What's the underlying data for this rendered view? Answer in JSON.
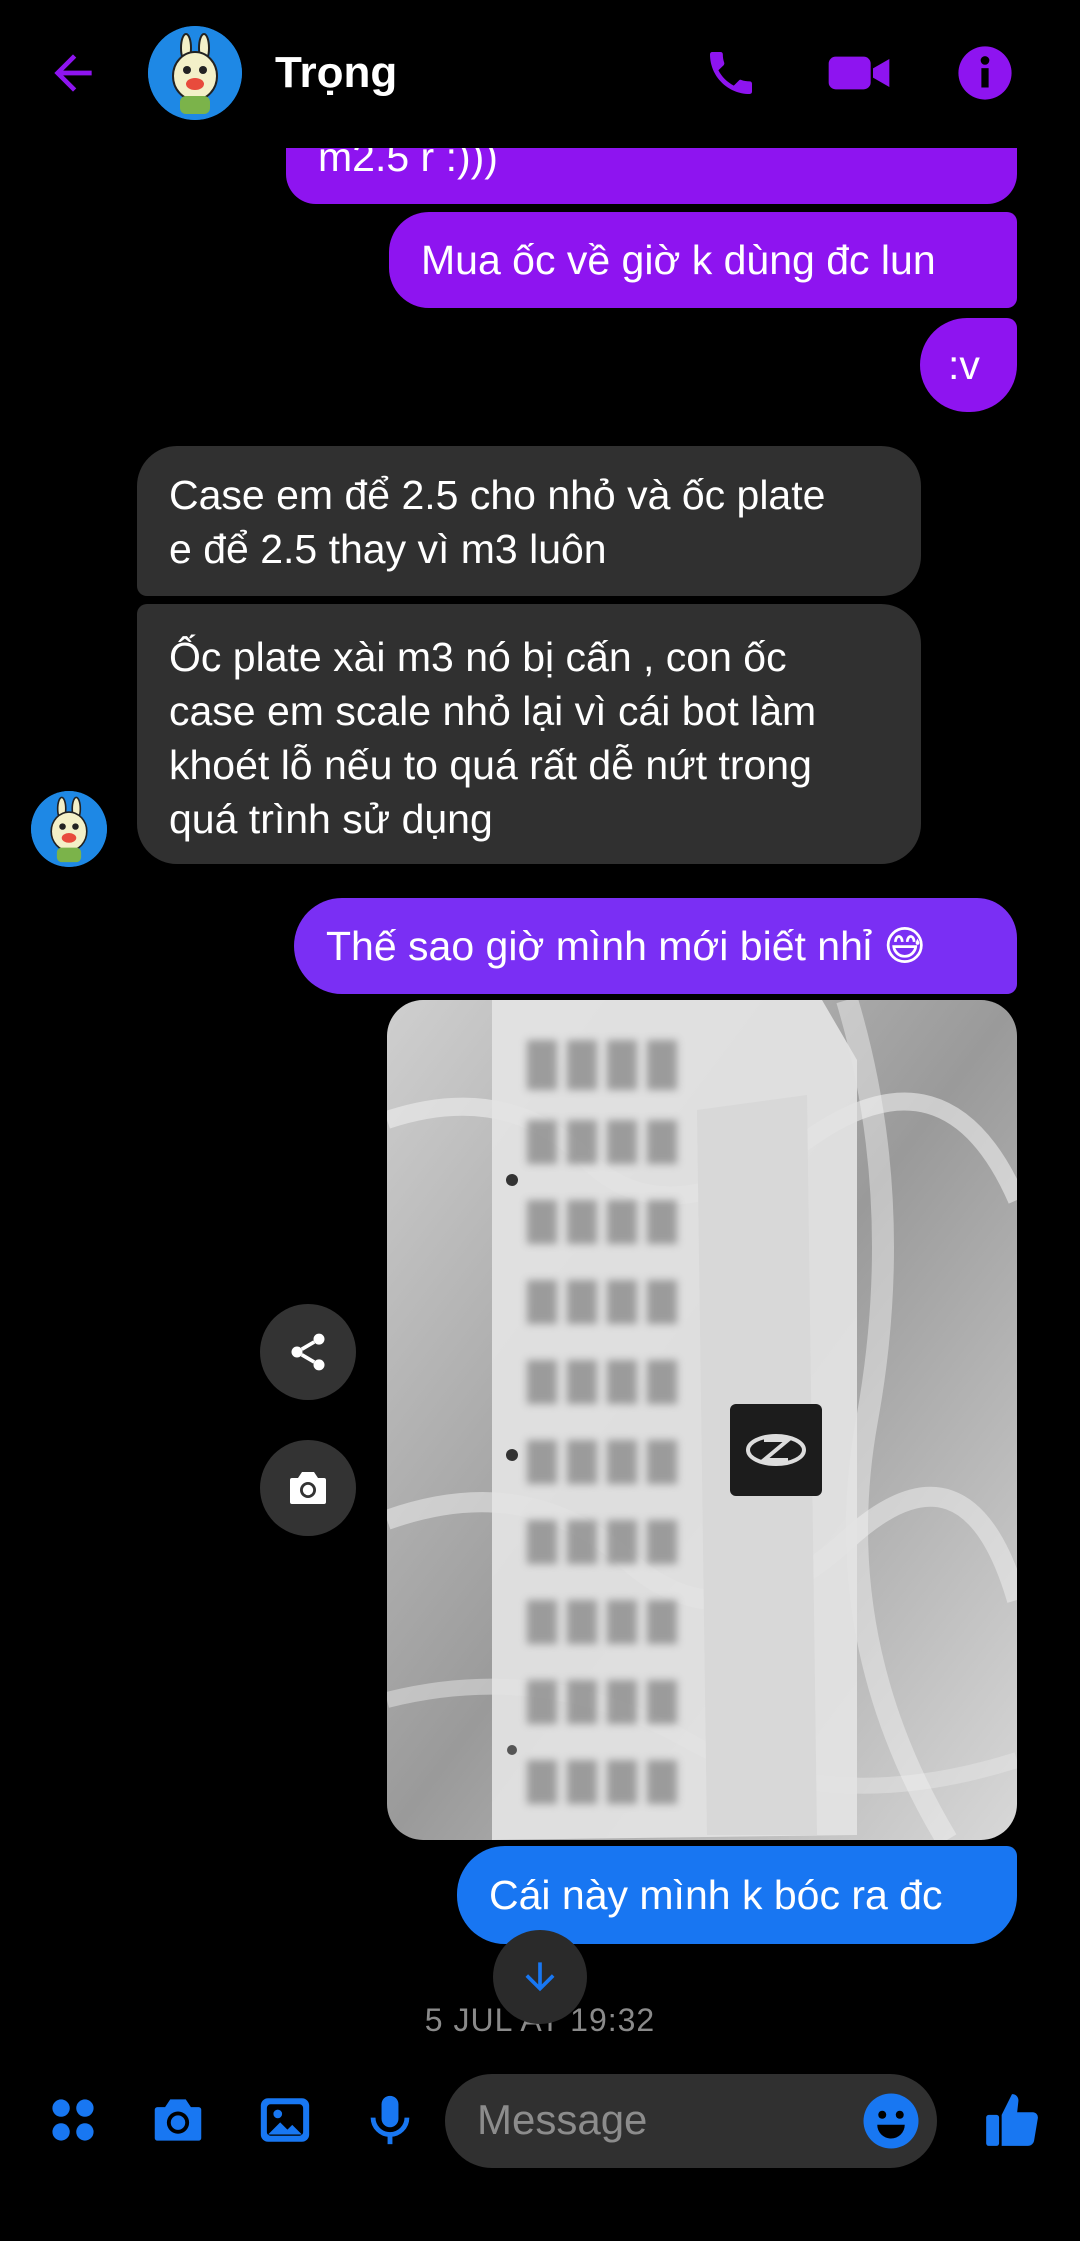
{
  "header": {
    "contact_name": "Trọng",
    "back_icon": "arrow-left-icon",
    "call_icon": "phone-icon",
    "video_icon": "video-camera-icon",
    "info_icon": "info-icon"
  },
  "messages": [
    {
      "id": "m0",
      "sender": "me",
      "text": "m2.5 r :)))"
    },
    {
      "id": "m1",
      "sender": "me",
      "text": "Mua ốc về giờ k dùng đc lun"
    },
    {
      "id": "m2",
      "sender": "me",
      "text": ":v"
    },
    {
      "id": "m3",
      "sender": "Trọng",
      "text": "Case em để 2.5 cho nhỏ và ốc plate\ne để 2.5 thay vì m3 luôn"
    },
    {
      "id": "m4",
      "sender": "Trọng",
      "text": "Ốc plate xài m3 nó bị cấn , con ốc\ncase em scale nhỏ lại vì cái bot làm\nkhoét lỗ nếu to quá rất dễ nứt trong\nquá trình sử dụng"
    },
    {
      "id": "m5",
      "sender": "me",
      "text": "Thế sao giờ mình mới biết nhỉ 😅"
    },
    {
      "id": "m6",
      "sender": "me",
      "type": "photo"
    },
    {
      "id": "m7",
      "sender": "me",
      "text": "Cái này mình k bóc ra đc"
    }
  ],
  "photo_actions": {
    "share_icon": "share-icon",
    "save_icon": "camera-icon"
  },
  "timestamp": "5 JUL AT 19:32",
  "scroll_down_icon": "arrow-down-icon",
  "composer": {
    "placeholder": "Message",
    "icons": [
      "apps-icon",
      "camera-icon",
      "gallery-icon",
      "microphone-icon",
      "emoji-icon",
      "thumbs-up-icon"
    ]
  },
  "colors": {
    "accent": "#8e14f0",
    "bubble_violet": "#7a2ff4",
    "bubble_blue": "#1876f2",
    "received": "#303030",
    "link_blue": "#1877f2"
  }
}
